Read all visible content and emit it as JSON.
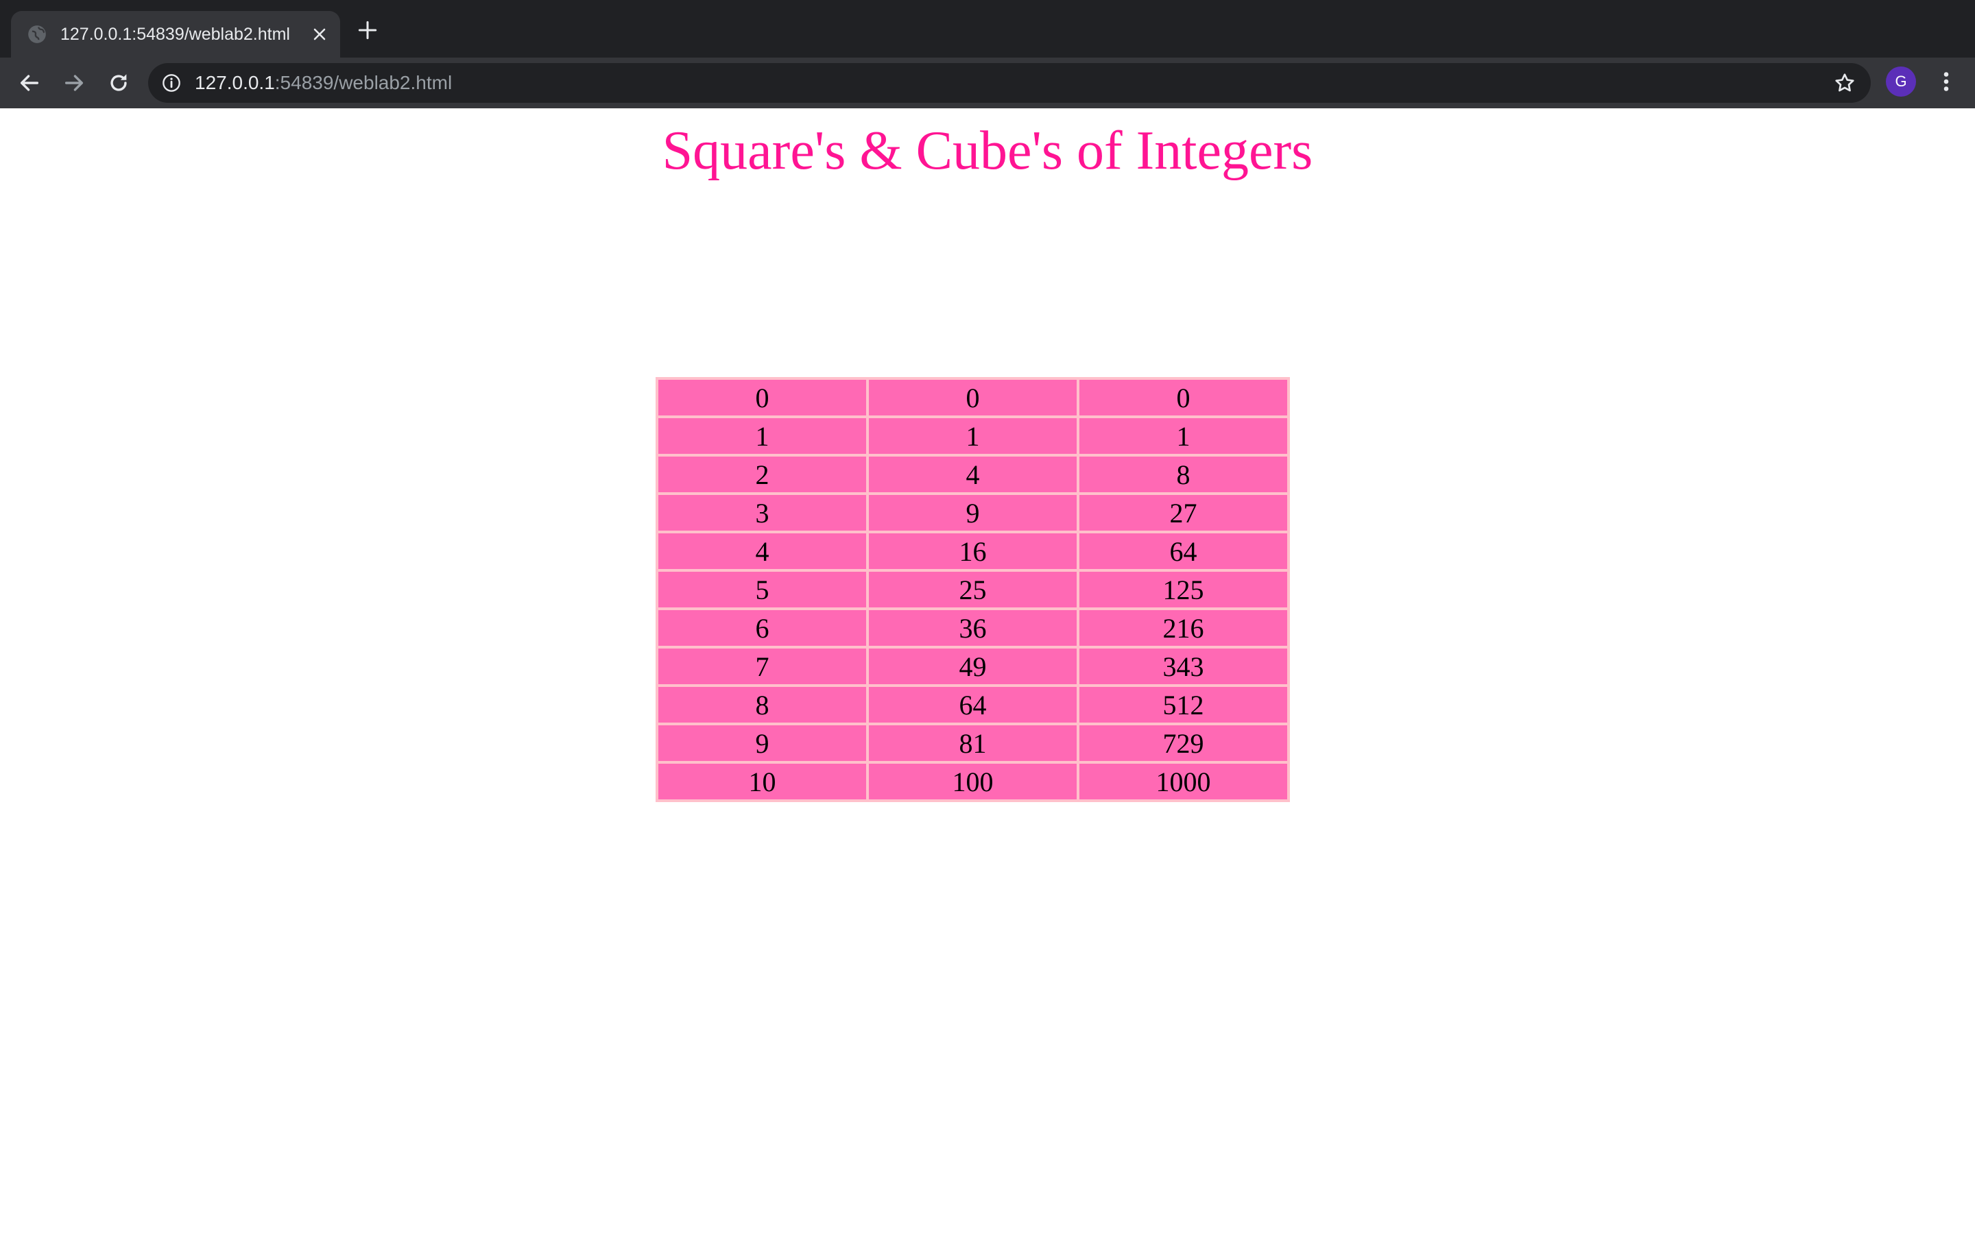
{
  "browser": {
    "tab_title": "127.0.0.1:54839/weblab2.html",
    "url_host": "127.0.0.1",
    "url_rest": ":54839/weblab2.html",
    "profile_initial": "G",
    "icons": [
      "globe-icon",
      "close-icon",
      "plus-icon",
      "back-arrow-icon",
      "forward-arrow-icon",
      "reload-icon",
      "info-icon",
      "star-icon",
      "kebab-menu-icon"
    ]
  },
  "page": {
    "title": "Square's & Cube's of Integers",
    "colors": {
      "title": "#ff1493",
      "cell_bg": "#ff69b4",
      "table_border": "#ffc0cb"
    },
    "rows": [
      [
        "0",
        "0",
        "0"
      ],
      [
        "1",
        "1",
        "1"
      ],
      [
        "2",
        "4",
        "8"
      ],
      [
        "3",
        "9",
        "27"
      ],
      [
        "4",
        "16",
        "64"
      ],
      [
        "5",
        "25",
        "125"
      ],
      [
        "6",
        "36",
        "216"
      ],
      [
        "7",
        "49",
        "343"
      ],
      [
        "8",
        "64",
        "512"
      ],
      [
        "9",
        "81",
        "729"
      ],
      [
        "10",
        "100",
        "1000"
      ]
    ]
  }
}
